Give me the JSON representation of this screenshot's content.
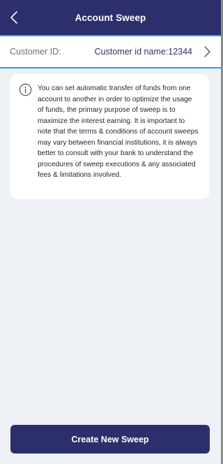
{
  "header": {
    "title": "Account Sweep",
    "back_icon": "chevron-left-icon"
  },
  "customer": {
    "label": "Customer ID:",
    "value": "Customer id name:12344",
    "nav_icon": "chevron-right-icon"
  },
  "info": {
    "icon": "info-circle-icon",
    "text": "You can set automatic transfer of funds from one account to another in order to optimize the usage of funds, the primary purpose of sweep is to maximize the interest earning. It is important to note that the terms & conditions of account sweeps may vary between financial institutions, it is always better to consult with your bank to understand the procedures of sweep executions & any associated fees & limitations involved."
  },
  "actions": {
    "create_label": "Create New Sweep"
  },
  "colors": {
    "primary": "#2c2f6b",
    "accent_border": "#2e9ff0",
    "background": "#eef1f5",
    "card": "#ffffff"
  }
}
